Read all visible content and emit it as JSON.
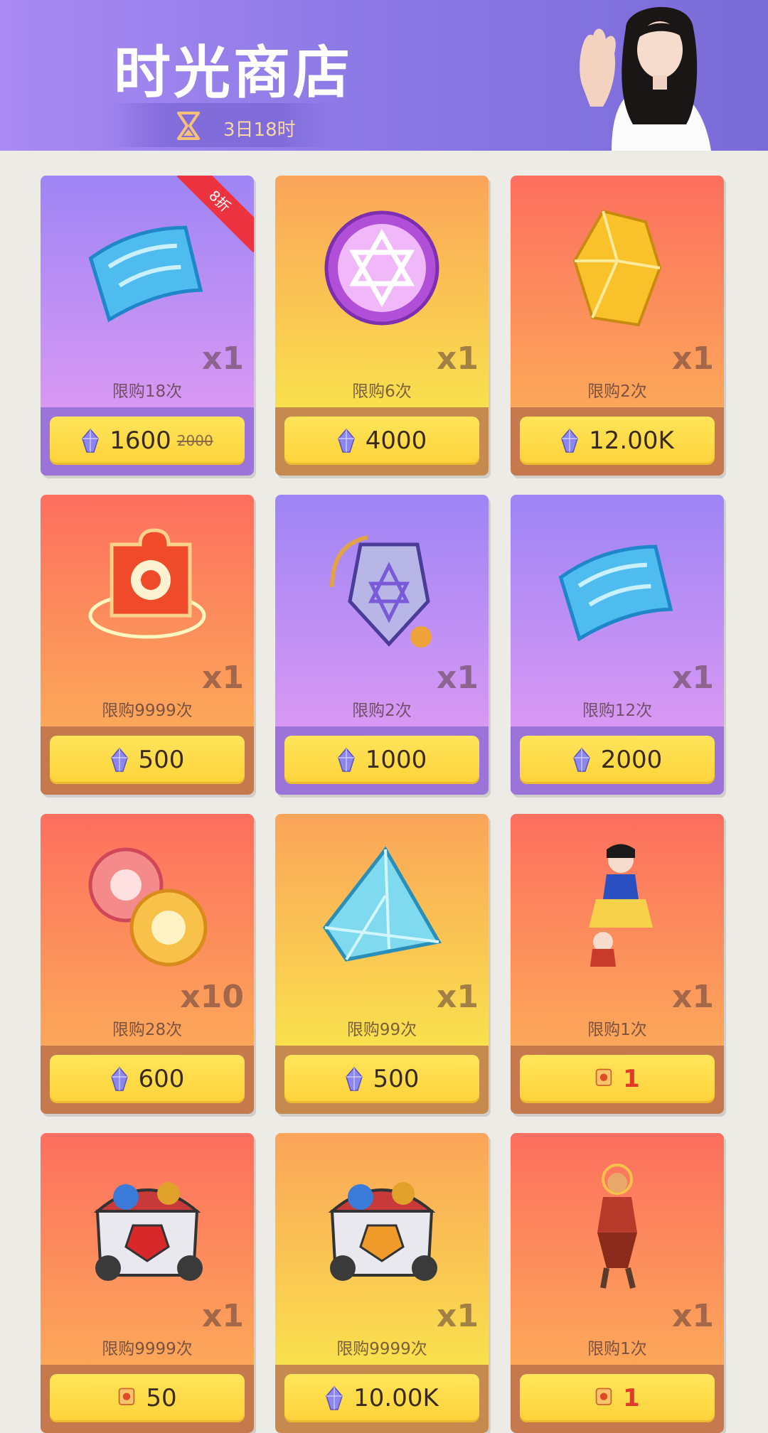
{
  "header": {
    "title": "时光商店",
    "timer": "3日18时"
  },
  "items": [
    {
      "theme": "purple",
      "image": "blue-ticket-icon",
      "qty": "x1",
      "limit": "限购18次",
      "price": "1600",
      "old_price": "2000",
      "discount": "8折",
      "currency": "crystal-icon"
    },
    {
      "theme": "orange",
      "image": "star-coin-icon",
      "qty": "x1",
      "limit": "限购6次",
      "price": "4000",
      "currency": "crystal-icon"
    },
    {
      "theme": "red",
      "image": "gold-gem-icon",
      "qty": "x1",
      "limit": "限购2次",
      "price": "12.00K",
      "currency": "crystal-icon"
    },
    {
      "theme": "red",
      "image": "puzzle-piece-icon",
      "qty": "x1",
      "limit": "限购9999次",
      "price": "500",
      "currency": "crystal-icon"
    },
    {
      "theme": "purple",
      "image": "amulet-icon",
      "qty": "x1",
      "limit": "限购2次",
      "price": "1000",
      "currency": "crystal-icon"
    },
    {
      "theme": "purple",
      "image": "blue-ticket-icon",
      "qty": "x1",
      "limit": "限购12次",
      "price": "2000",
      "currency": "crystal-icon"
    },
    {
      "theme": "red",
      "image": "spin-tokens-icon",
      "qty": "x10",
      "limit": "限购28次",
      "price": "600",
      "currency": "crystal-icon"
    },
    {
      "theme": "orange",
      "image": "pyramid-crystal-icon",
      "qty": "x1",
      "limit": "限购99次",
      "price": "500",
      "currency": "crystal-icon"
    },
    {
      "theme": "red",
      "image": "princess-skin-icon",
      "qty": "x1",
      "limit": "限购1次",
      "price": "1",
      "currency": "skin-voucher-icon",
      "price_red": true
    },
    {
      "theme": "red",
      "image": "treasure-chest-red-icon",
      "qty": "x1",
      "limit": "限购9999次",
      "price": "50",
      "currency": "gold-voucher-icon"
    },
    {
      "theme": "orange",
      "image": "treasure-chest-gold-icon",
      "qty": "x1",
      "limit": "限购9999次",
      "price": "10.00K",
      "currency": "crystal-icon"
    },
    {
      "theme": "red",
      "image": "monkey-king-skin-icon",
      "qty": "x1",
      "limit": "限购1次",
      "price": "1",
      "currency": "skin-voucher-icon",
      "price_red": true
    }
  ]
}
